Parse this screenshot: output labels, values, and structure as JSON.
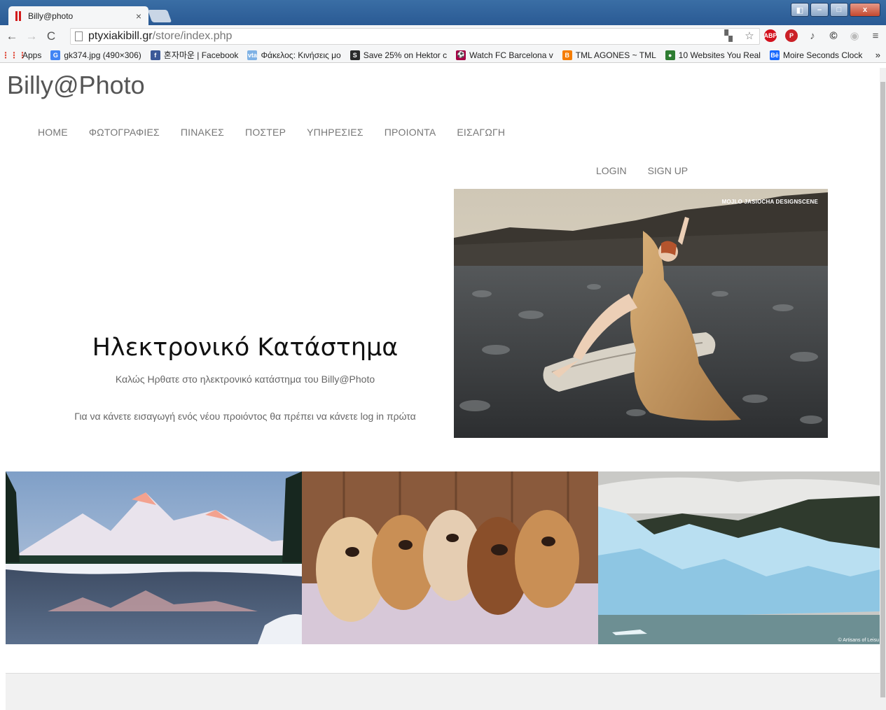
{
  "browser": {
    "tab_title": "Billy@photo",
    "tab_close": "×",
    "url_host": "ptyxiakibill.gr",
    "url_path": "/store/index.php",
    "window_buttons": [
      "◧",
      "–",
      "□",
      "x"
    ],
    "bookmarks": [
      {
        "label": "Apps",
        "icon": "apps-grid-icon",
        "color": "#e04b3b"
      },
      {
        "label": "gk374.jpg (490×306)",
        "icon": "google-icon",
        "color": "#4285f4",
        "glyph": "G"
      },
      {
        "label": "혼자마운 | Facebook",
        "icon": "facebook-icon",
        "color": "#3b5998",
        "glyph": "f"
      },
      {
        "label": "Φάκελος: Κινήσεις μο",
        "icon": "vta-icon",
        "color": "#7fb2e5",
        "glyph": "vta"
      },
      {
        "label": "Save 25% on Hektor c",
        "icon": "steam-icon",
        "color": "#2a2a2a",
        "glyph": "S"
      },
      {
        "label": "Watch FC Barcelona v",
        "icon": "barcelona-crest-icon",
        "color": "#a50044",
        "glyph": "⚽"
      },
      {
        "label": "TML AGONES ~ TML",
        "icon": "blogger-icon",
        "color": "#f57d00",
        "glyph": "B"
      },
      {
        "label": "10 Websites You Real",
        "icon": "green-dot-icon",
        "color": "#2e7d32",
        "glyph": "●"
      },
      {
        "label": "Moire Seconds Clock",
        "icon": "behance-icon",
        "color": "#1769ff",
        "glyph": "Bē"
      }
    ],
    "bookmarks_more": "»",
    "extensions": [
      {
        "name": "translate-icon",
        "glyph": "▚",
        "color": "#666"
      },
      {
        "name": "bookmark-star-icon",
        "glyph": "☆",
        "color": "#666"
      },
      {
        "name": "adblock-plus-icon",
        "glyph": "ABP",
        "color": "#d3111d"
      },
      {
        "name": "pinterest-icon",
        "glyph": "P",
        "color": "#cb2027"
      },
      {
        "name": "tool-extension-icon",
        "glyph": "♪",
        "color": "#555"
      },
      {
        "name": "copyright-extension-icon",
        "glyph": "©",
        "color": "#333"
      },
      {
        "name": "grey-circle-extension-icon",
        "glyph": "◉",
        "color": "#bbb"
      },
      {
        "name": "chrome-menu-icon",
        "glyph": "≡",
        "color": "#555"
      }
    ]
  },
  "site": {
    "brand": "Billy@Photo",
    "nav": [
      "HOME",
      "ΦΩΤΟΓΡΑΦΙΕΣ",
      "ΠΙΝΑΚΕΣ",
      "ΠΟΣΤΕΡ",
      "ΥΠΗΡΕΣΙΕΣ",
      "ΠΡΟΙΟΝΤΑ",
      "ΕΙΣΑΓΩΓΗ"
    ],
    "auth": [
      "LOGIN",
      "SIGN UP"
    ],
    "hero": {
      "title": "Ηλεκτρονικό Κατάστημα",
      "subtitle": "Καλώς Ηρθατε στο ηλεκτρονικό κατάστημα του Billy@Photo",
      "note": "Για να κάνετε εισαγωγή ενός νέου προιόντος θα πρέπει να κάνετε log in πρώτα",
      "photo_watermark": "MOJLO JASIOCHA DESIGNSCENE"
    },
    "gallery_credit": "© Artisans of Leisu"
  }
}
